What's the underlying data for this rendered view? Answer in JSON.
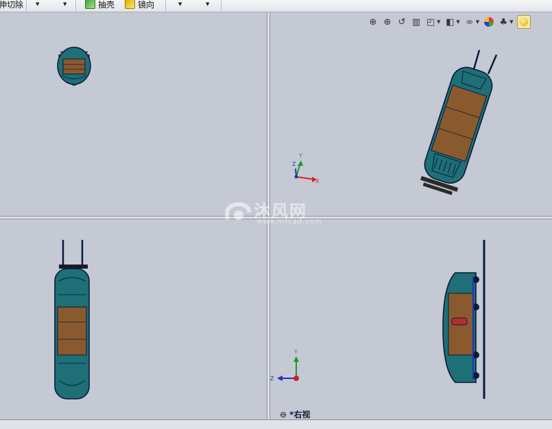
{
  "toolbar": {
    "cut_label": "拉伸切除",
    "shell_label": "抽壳",
    "mirror_label": "镜向"
  },
  "view_toolbar": {
    "icons": [
      "zoom-to-fit-icon",
      "zoom-area-icon",
      "previous-view-icon",
      "section-view-icon",
      "view-orientation-icon",
      "display-style-icon",
      "hide-show-icon",
      "appearance-icon",
      "scene-icon",
      "realview-icon"
    ]
  },
  "triad_top_right": {
    "x_label": "X",
    "y_label": "Y",
    "z_label": "Z"
  },
  "triad_bottom_right": {
    "y_label": "Y",
    "z_label": "Z"
  },
  "watermark": {
    "text": "沐风网",
    "url": "www.mfcad.com"
  },
  "view_label": {
    "text": "*右视"
  },
  "colors": {
    "body": "#8a5a2e",
    "frame": "#1e6f76",
    "edge": "#0a1a3a",
    "background": "#c4c9d3"
  }
}
